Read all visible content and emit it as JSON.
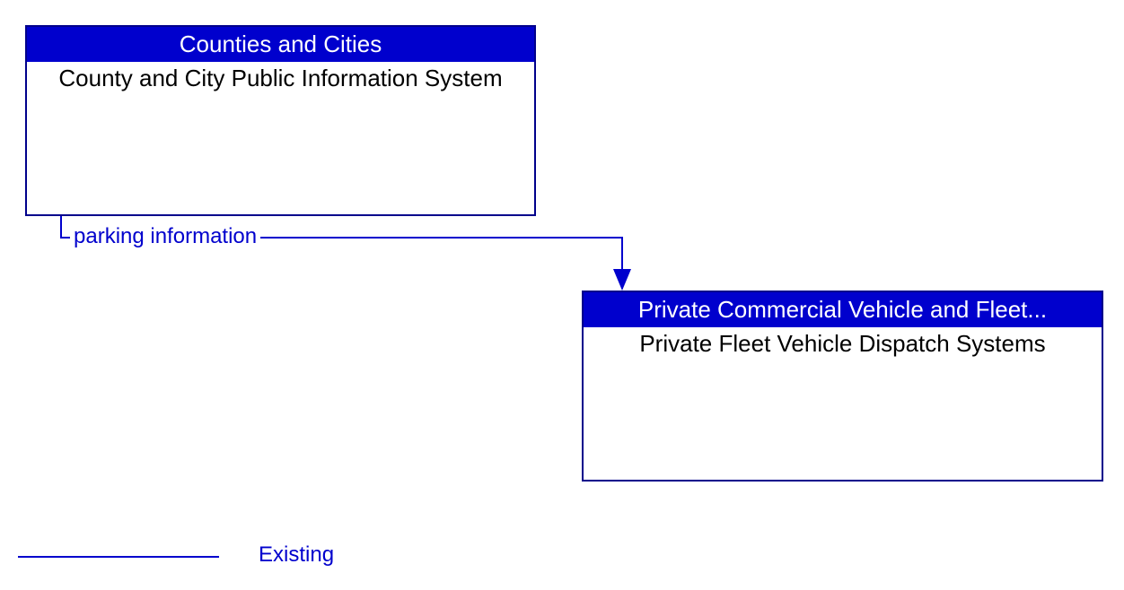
{
  "boxes": {
    "source": {
      "header": "Counties and Cities",
      "body": "County and City Public Information System"
    },
    "target": {
      "header": "Private Commercial Vehicle and Fleet...",
      "body": "Private Fleet Vehicle Dispatch Systems"
    }
  },
  "flow": {
    "label": "parking information"
  },
  "legend": {
    "label": "Existing"
  }
}
